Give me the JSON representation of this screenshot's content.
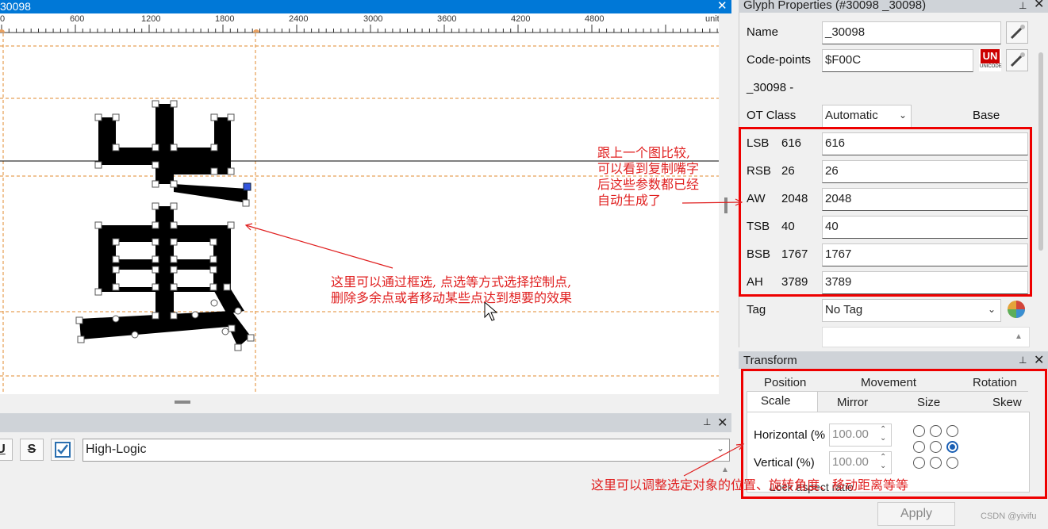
{
  "editor": {
    "title": "30098",
    "close": "✕",
    "ruler_labels": [
      "0",
      "600",
      "1200",
      "1800",
      "2400",
      "3000",
      "3600",
      "4200",
      "4800",
      "units"
    ]
  },
  "text_panel": {
    "underline_label": "U",
    "strike_label": "S",
    "text_value": "High-Logic",
    "pin": "🖈",
    "close": "✕"
  },
  "glyph_properties": {
    "title": "Glyph Properties (#30098 _30098)",
    "name_label": "Name",
    "name_value": "_30098",
    "codepoints_label": "Code-points",
    "codepoints_value": "$F00C",
    "unicode_badge": "UN",
    "unicode_sub": "UNICODE",
    "glyph_desc": "_30098 -",
    "ot_class_label": "OT Class",
    "ot_class_value": "Automatic",
    "base_label": "Base",
    "metrics": [
      {
        "label": "LSB",
        "value": "616",
        "input": "616"
      },
      {
        "label": "RSB",
        "value": "26",
        "input": "26"
      },
      {
        "label": "AW",
        "value": "2048",
        "input": "2048"
      },
      {
        "label": "TSB",
        "value": "40",
        "input": "40"
      },
      {
        "label": "BSB",
        "value": "1767",
        "input": "1767"
      },
      {
        "label": "AH",
        "value": "3789",
        "input": "3789"
      }
    ],
    "tag_label": "Tag",
    "tag_value": "No Tag"
  },
  "transform": {
    "title": "Transform",
    "tabs_row1": [
      "Position",
      "Movement",
      "Rotation"
    ],
    "tabs_row2": [
      "Scale",
      "Mirror",
      "Size",
      "Skew"
    ],
    "horizontal_label": "Horizontal (%",
    "horizontal_value": "100.00",
    "vertical_label": "Vertical (%)",
    "vertical_value": "100.00",
    "lock_label": "Lock aspect ratio",
    "apply_label": "Apply"
  },
  "annotations": {
    "metrics_note": [
      "跟上一个图比较,",
      "可以看到复制嘴字",
      "后这些参数都已经",
      "自动生成了"
    ],
    "points_note": [
      "这里可以通过框选, 点选等方式选择控制点,",
      "删除多余点或者移动某些点达到想要的效果"
    ],
    "transform_note": "这里可以调整选定对象的位置、旋转角度、移动距离等等"
  },
  "watermark": "CSDN @yivifu",
  "colors": {
    "titlebar": "#0078d7",
    "annotation_red": "#e02020",
    "guide_orange": "#e08a2e",
    "selected_radio": "#1a5fb4"
  }
}
